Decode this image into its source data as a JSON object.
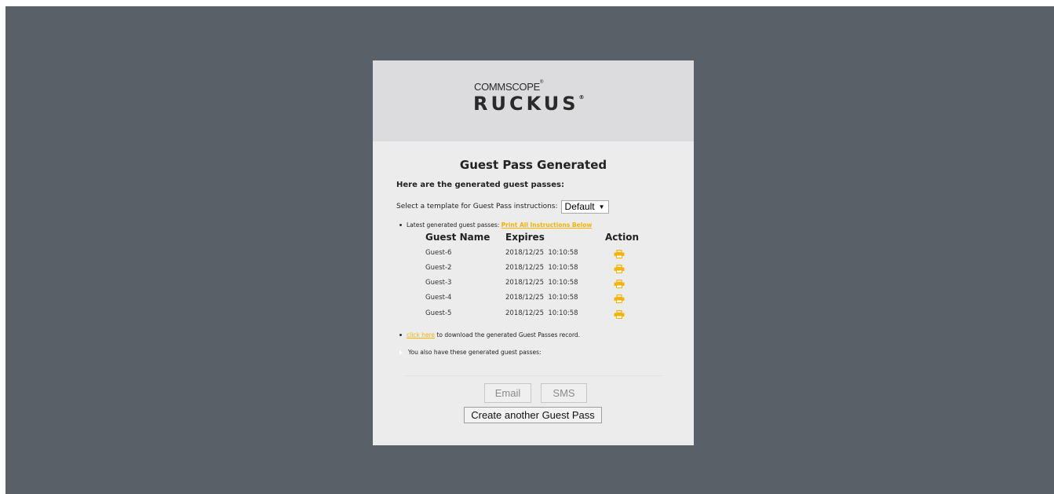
{
  "brand": {
    "parent": "COMMSCOPE",
    "product": "RUCKUS"
  },
  "page": {
    "title": "Guest Pass Generated",
    "intro": "Here are the generated guest passes:",
    "template_label": "Select a template for Guest Pass instructions:",
    "template_value": "Default"
  },
  "passes": {
    "latest_label": "Latest generated guest passes:",
    "print_all_link": "Print All Instructions Below",
    "columns": [
      "Guest Name",
      "Expires",
      "Action"
    ],
    "rows": [
      {
        "name": "Guest-6",
        "expires": "2018/12/25  10:10:58",
        "action_icon": "printer-icon"
      },
      {
        "name": "Guest-2",
        "expires": "2018/12/25  10:10:58",
        "action_icon": "printer-icon"
      },
      {
        "name": "Guest-3",
        "expires": "2018/12/25  10:10:58",
        "action_icon": "printer-icon"
      },
      {
        "name": "Guest-4",
        "expires": "2018/12/25  10:10:58",
        "action_icon": "printer-icon"
      },
      {
        "name": "Guest-5",
        "expires": "2018/12/25  10:10:58",
        "action_icon": "printer-icon"
      }
    ],
    "download_link": "click here",
    "download_text": "to download the generated Guest Passes record.",
    "also_text": "You also have these generated guest passes:"
  },
  "buttons": {
    "email": "Email",
    "sms": "SMS",
    "create": "Create another Guest Pass"
  },
  "colors": {
    "backdrop": "#5a6068",
    "accent": "#f5b400"
  }
}
